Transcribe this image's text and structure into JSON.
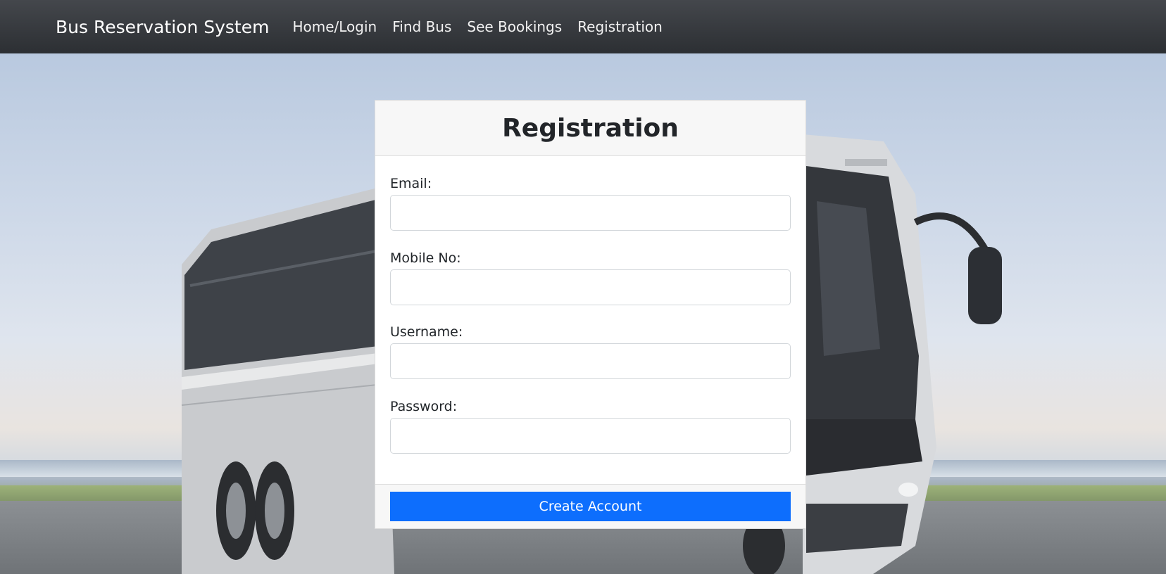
{
  "navbar": {
    "brand": "Bus Reservation System",
    "links": [
      {
        "label": "Home/Login"
      },
      {
        "label": "Find Bus"
      },
      {
        "label": "See Bookings"
      },
      {
        "label": "Registration"
      }
    ]
  },
  "background": {
    "description_icon": "bus-photo"
  },
  "registration": {
    "title": "Registration",
    "fields": [
      {
        "label": "Email:",
        "value": "",
        "placeholder": ""
      },
      {
        "label": "Mobile No:",
        "value": "",
        "placeholder": ""
      },
      {
        "label": "Username:",
        "value": "",
        "placeholder": ""
      },
      {
        "label": "Password:",
        "value": "",
        "placeholder": ""
      }
    ],
    "submit_label": "Create Account"
  },
  "colors": {
    "navbar": "#343a40",
    "primary_button": "#0d6efd",
    "card_header": "#f7f7f7"
  }
}
